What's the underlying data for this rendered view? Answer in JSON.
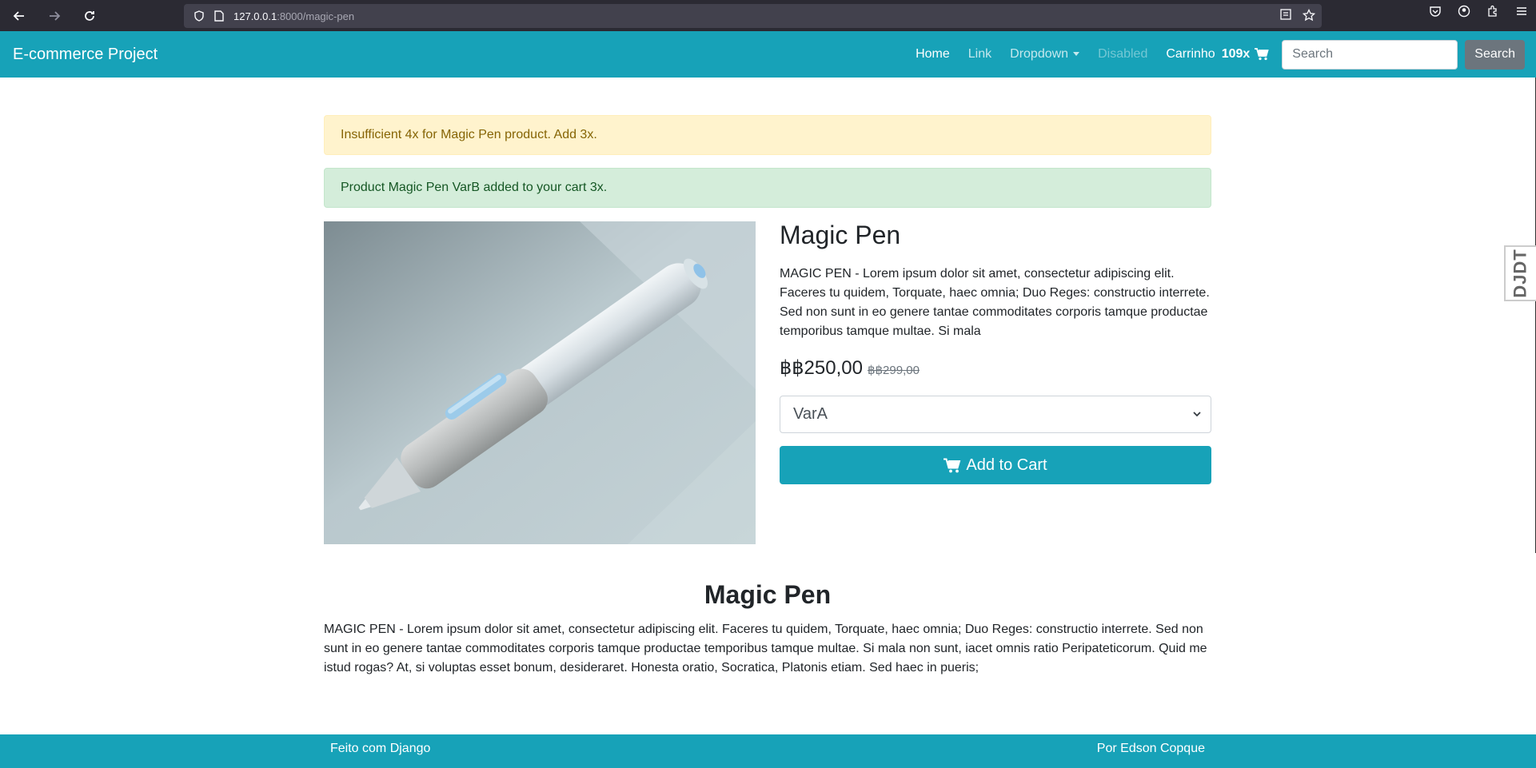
{
  "browser": {
    "url_host": "127.0.0.1",
    "url_path": ":8000/magic-pen"
  },
  "navbar": {
    "brand": "E-commerce Project",
    "links": {
      "home": "Home",
      "link": "Link",
      "dropdown": "Dropdown",
      "disabled": "Disabled"
    },
    "cart_label": "Carrinho",
    "cart_count": "109x",
    "search_placeholder": "Search",
    "search_button": "Search"
  },
  "alerts": {
    "warning": "Insufficient 4x for Magic Pen product. Add 3x.",
    "success": "Product Magic Pen VarB added to your cart 3x."
  },
  "product": {
    "title": "Magic Pen",
    "short_description": "MAGIC PEN - Lorem ipsum dolor sit amet, consectetur adipiscing elit. Faceres tu quidem, Torquate, haec omnia; Duo Reges: constructio interrete. Sed non sunt in eo genere tantae commoditates corporis tamque productae temporibus tamque multae. Si mala",
    "price": "฿฿250,00",
    "old_price": "฿฿299,00",
    "selected_variant": "VarA",
    "add_to_cart": "Add to Cart"
  },
  "details": {
    "title": "Magic Pen",
    "long_description": "MAGIC PEN - Lorem ipsum dolor sit amet, consectetur adipiscing elit. Faceres tu quidem, Torquate, haec omnia; Duo Reges: constructio interrete. Sed non sunt in eo genere tantae commoditates corporis tamque productae temporibus tamque multae. Si mala non sunt, iacet omnis ratio Peripateticorum. Quid me istud rogas? At, si voluptas esset bonum, desideraret. Honesta oratio, Socratica, Platonis etiam. Sed haec in pueris;"
  },
  "footer": {
    "left": "Feito com Django",
    "right": "Por Edson Copque"
  },
  "debug_toolbar": {
    "label": "DJDT"
  },
  "colors": {
    "primary": "#17a2b8",
    "warning_bg": "#fff3cd",
    "success_bg": "#d4edda"
  }
}
